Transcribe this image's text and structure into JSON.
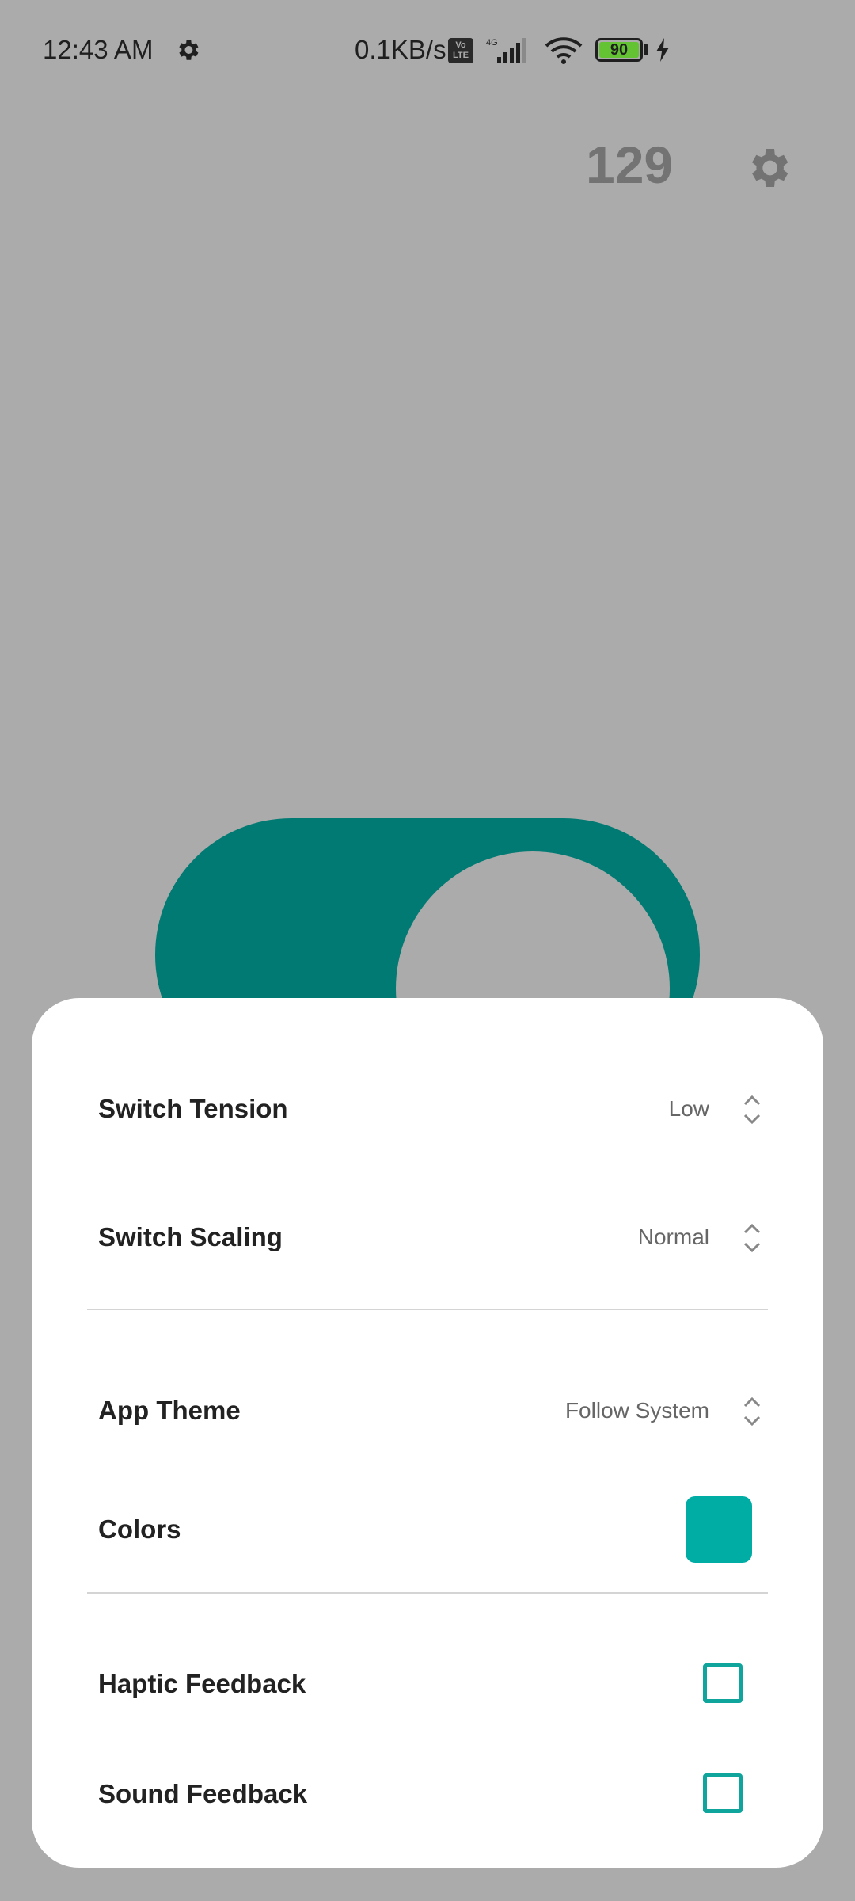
{
  "status_bar": {
    "time": "12:43 AM",
    "net_speed": "0.1KB/s",
    "volte": "Vo LTE",
    "network": "4G",
    "battery": "90",
    "battery_color": "#63c332"
  },
  "header": {
    "counter": "129",
    "settings_icon": "gear-icon"
  },
  "switch": {
    "color": "#007a73",
    "state": "on"
  },
  "settings": {
    "switch_tension": {
      "label": "Switch Tension",
      "value": "Low"
    },
    "switch_scaling": {
      "label": "Switch Scaling",
      "value": "Normal"
    },
    "app_theme": {
      "label": "App Theme",
      "value": "Follow System"
    },
    "colors": {
      "label": "Colors",
      "swatch": "#00ada5"
    },
    "haptic_feedback": {
      "label": "Haptic Feedback",
      "checked": false
    },
    "sound_feedback": {
      "label": "Sound Feedback",
      "checked": false
    }
  }
}
